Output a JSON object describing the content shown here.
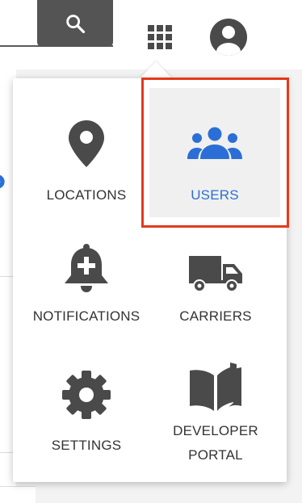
{
  "header": {
    "search_button_icon": "search-icon",
    "apps_button_icon": "apps-grid-icon",
    "account_button_icon": "account-circle-icon"
  },
  "menu": {
    "items": [
      {
        "id": "locations",
        "label": "LOCATIONS",
        "icon": "location-pin-icon",
        "selected": false
      },
      {
        "id": "users",
        "label": "USERS",
        "icon": "users-group-icon",
        "selected": true
      },
      {
        "id": "notifications",
        "label": "NOTIFICATIONS",
        "icon": "bell-plus-icon",
        "selected": false
      },
      {
        "id": "carriers",
        "label": "CARRIERS",
        "icon": "truck-icon",
        "selected": false
      },
      {
        "id": "settings",
        "label": "SETTINGS",
        "icon": "gear-icon",
        "selected": false
      },
      {
        "id": "developer_portal",
        "label_line1": "DEVELOPER",
        "label_line2": "PORTAL",
        "icon": "book-icon",
        "selected": false
      }
    ]
  },
  "colors": {
    "icon_gray": "#4a4a4a",
    "active_blue": "#2b6fd6",
    "highlight_red": "#e33a1c",
    "selected_tile_bg": "#f0f0f0"
  }
}
